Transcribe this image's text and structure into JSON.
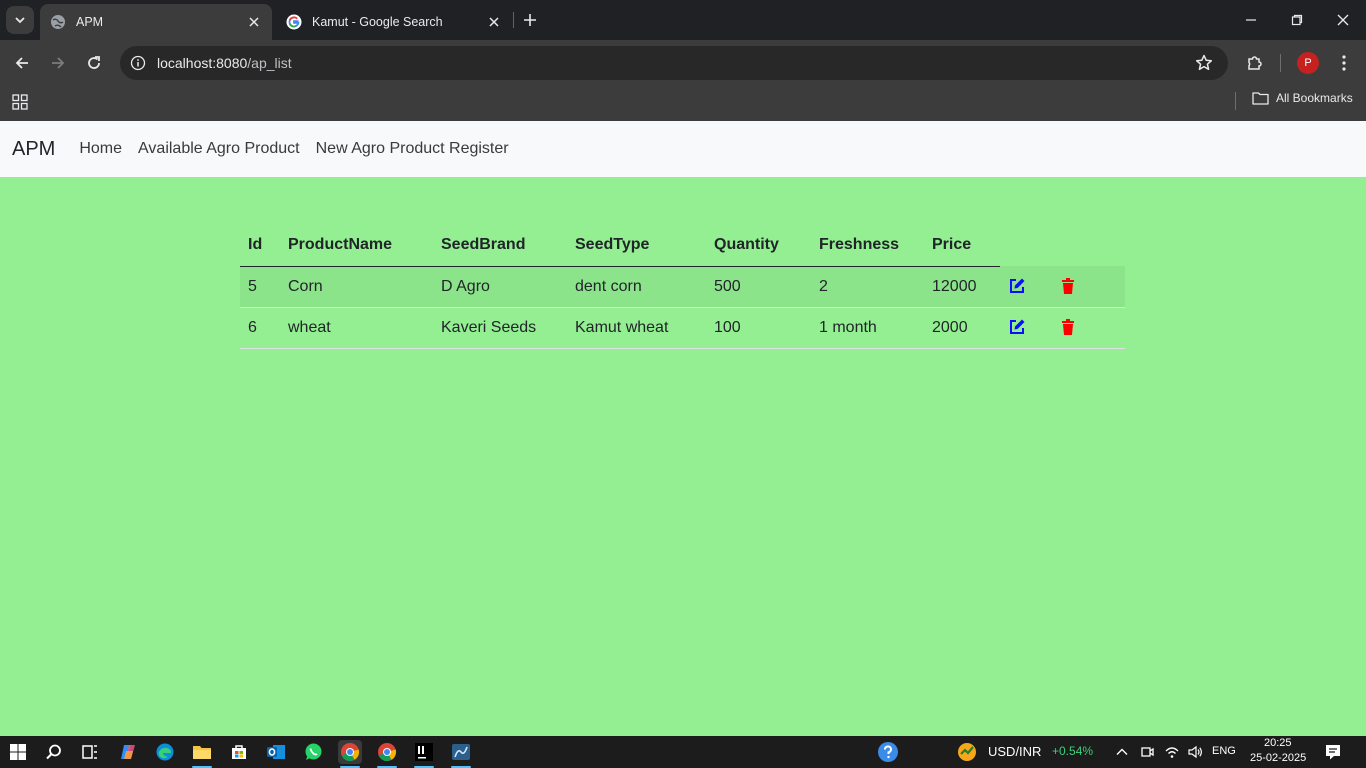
{
  "browser": {
    "tabs": [
      {
        "title": "APM",
        "active": true
      },
      {
        "title": "Kamut - Google Search",
        "active": false
      }
    ],
    "url_host": "localhost:8080",
    "url_path": "/ap_list",
    "profile_initial": "P",
    "bookmarks_label": "All Bookmarks"
  },
  "navbar": {
    "brand": "APM",
    "links": [
      "Home",
      "Available Agro Product",
      "New Agro Product Register"
    ]
  },
  "table": {
    "headers": [
      "Id",
      "ProductName",
      "SeedBrand",
      "SeedType",
      "Quantity",
      "Freshness",
      "Price"
    ],
    "rows": [
      {
        "id": "5",
        "product_name": "Corn",
        "seed_brand": "D Agro",
        "seed_type": "dent corn",
        "quantity": "500",
        "freshness": "2",
        "price": "12000"
      },
      {
        "id": "6",
        "product_name": "wheat",
        "seed_brand": "Kaveri Seeds",
        "seed_type": "Kamut wheat",
        "quantity": "100",
        "freshness": "1 month",
        "price": "2000"
      }
    ],
    "row_actions": [
      {
        "name": "edit",
        "icon": "edit-icon",
        "color": "#0d0dff"
      },
      {
        "name": "delete",
        "icon": "trash-icon",
        "color": "#ff0000"
      }
    ]
  },
  "colors": {
    "page_background": "#93ef91",
    "navbar_background": "#f8f9fa",
    "browser_frame": "#202124"
  },
  "taskbar": {
    "apps": [
      "start-icon",
      "search-icon",
      "task-view-icon",
      "copilot-icon",
      "edge-icon",
      "file-explorer-icon",
      "store-icon",
      "outlook-icon",
      "whatsapp-icon",
      "chrome-icon",
      "chrome-icon",
      "intellij-icon",
      "mysql-workbench-icon"
    ],
    "ticker_label": "USD/INR",
    "ticker_change": "+0.54%",
    "language": "ENG",
    "time": "20:25",
    "date": "25-02-2025"
  }
}
